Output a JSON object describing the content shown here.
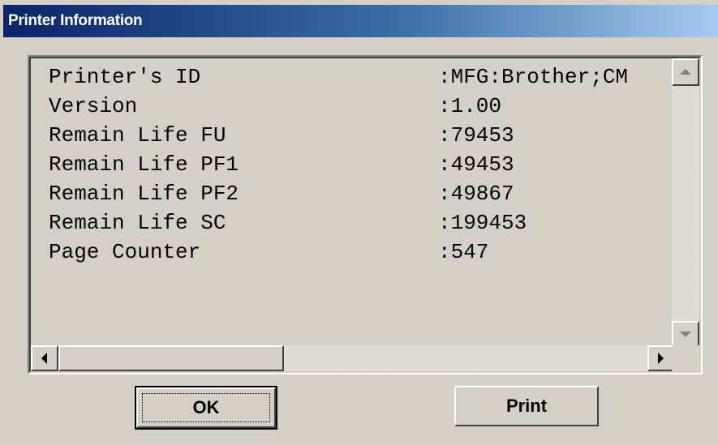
{
  "window": {
    "title": "Printer Information"
  },
  "info_rows": [
    {
      "label": "Printer's ID",
      "value": ":MFG:Brother;CM"
    },
    {
      "label": "Version",
      "value": ":1.00"
    },
    {
      "label": "Remain Life FU",
      "value": ":79453"
    },
    {
      "label": "Remain Life PF1",
      "value": ":49453"
    },
    {
      "label": "Remain Life PF2",
      "value": ":49867"
    },
    {
      "label": "Remain Life SC",
      "value": ":199453"
    },
    {
      "label": "Page Counter",
      "value": ":547"
    }
  ],
  "scrollbar": {
    "up_icon": "scroll-up-arrow-icon",
    "down_icon": "scroll-down-arrow-icon",
    "left_icon": "scroll-left-arrow-icon",
    "right_icon": "scroll-right-arrow-icon"
  },
  "buttons": {
    "ok_label": "OK",
    "print_label": "Print"
  },
  "colors": {
    "title_start": "#0a246a",
    "title_end": "#a6caf0",
    "face": "#d4d0c8"
  }
}
